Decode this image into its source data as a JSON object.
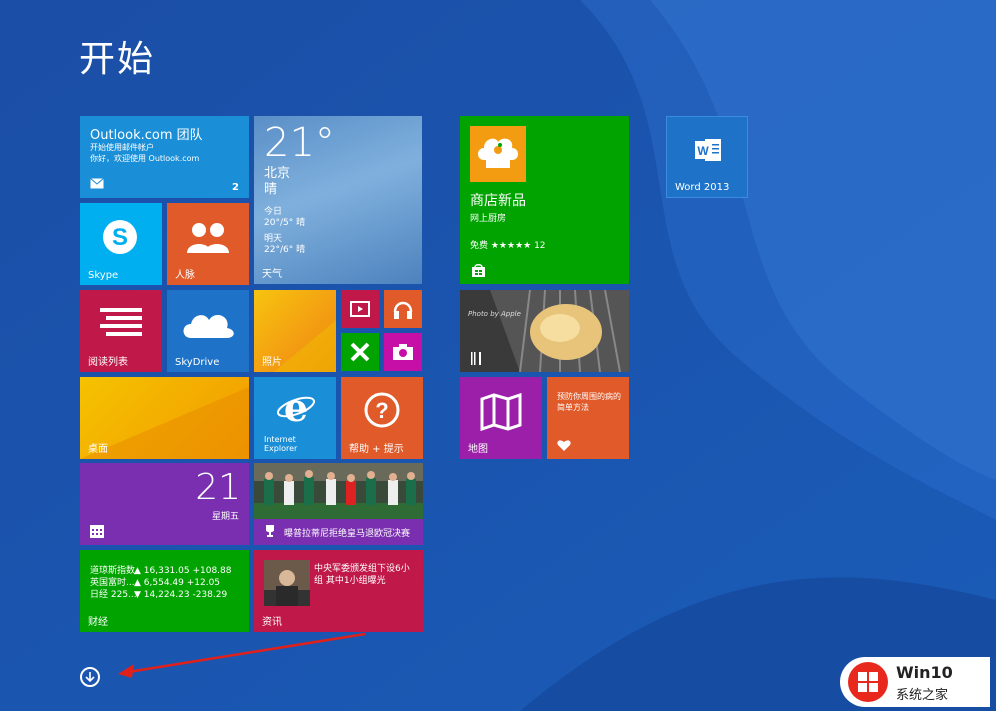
{
  "screen": {
    "title": "开始"
  },
  "tiles": {
    "outlook": {
      "title": "Outlook.com 团队",
      "line1": "开始使用邮件帐户",
      "line2": "你好，欢迎使用 Outlook.com",
      "count": "2"
    },
    "weather": {
      "temp": "21°",
      "city": "北京",
      "cond": "晴",
      "today_label": "今日",
      "today_range": "20°/5° 晴",
      "tomorrow_label": "明天",
      "tomorrow_range": "22°/6° 晴",
      "label": "天气"
    },
    "skype": {
      "label": "Skype"
    },
    "people": {
      "label": "人脉"
    },
    "reading": {
      "label": "阅读列表"
    },
    "skydrive": {
      "label": "SkyDrive"
    },
    "photos": {
      "label": "照片"
    },
    "desktop": {
      "label": "桌面"
    },
    "ie": {
      "label1": "Internet",
      "label2": "Explorer"
    },
    "help": {
      "label": "帮助 + 提示"
    },
    "calendar": {
      "day": "21",
      "weekday": "星期五"
    },
    "sports": {
      "caption": "曝普拉蒂尼拒绝皇马退欧冠决赛"
    },
    "finance": {
      "label": "财经",
      "rows": [
        {
          "name": "道琼斯指数",
          "val": "▲ 16,331.05 +108.88"
        },
        {
          "name": "英国富时...",
          "val": "▲ 6,554.49 +12.05"
        },
        {
          "name": "日经 225...",
          "val": "▼ 14,224.23 -238.29"
        }
      ]
    },
    "news": {
      "headline": "中央军委颁发组下设6小组 其中1小组曝光",
      "label": "资讯"
    },
    "store": {
      "title": "商店新品",
      "sub": "网上厨房",
      "rating": "免费 ★★★★★ 12"
    },
    "food": {
      "photo_text": "Photo by Apple"
    },
    "maps": {
      "label": "地图"
    },
    "health": {
      "label": "预防你周围的病的简单方法"
    },
    "word": {
      "label": "Word 2013"
    }
  },
  "watermark": {
    "brand": "Win10",
    "sub": "系统之家"
  },
  "colors": {
    "bg": "#1a56b0",
    "outlook": "#1a8fd7",
    "green": "#00a300",
    "orange": "#e05a2a",
    "crimson": "#c01848",
    "purple": "#7a2fb0",
    "magenta": "#c50fa6",
    "blue": "#1e73c8"
  }
}
